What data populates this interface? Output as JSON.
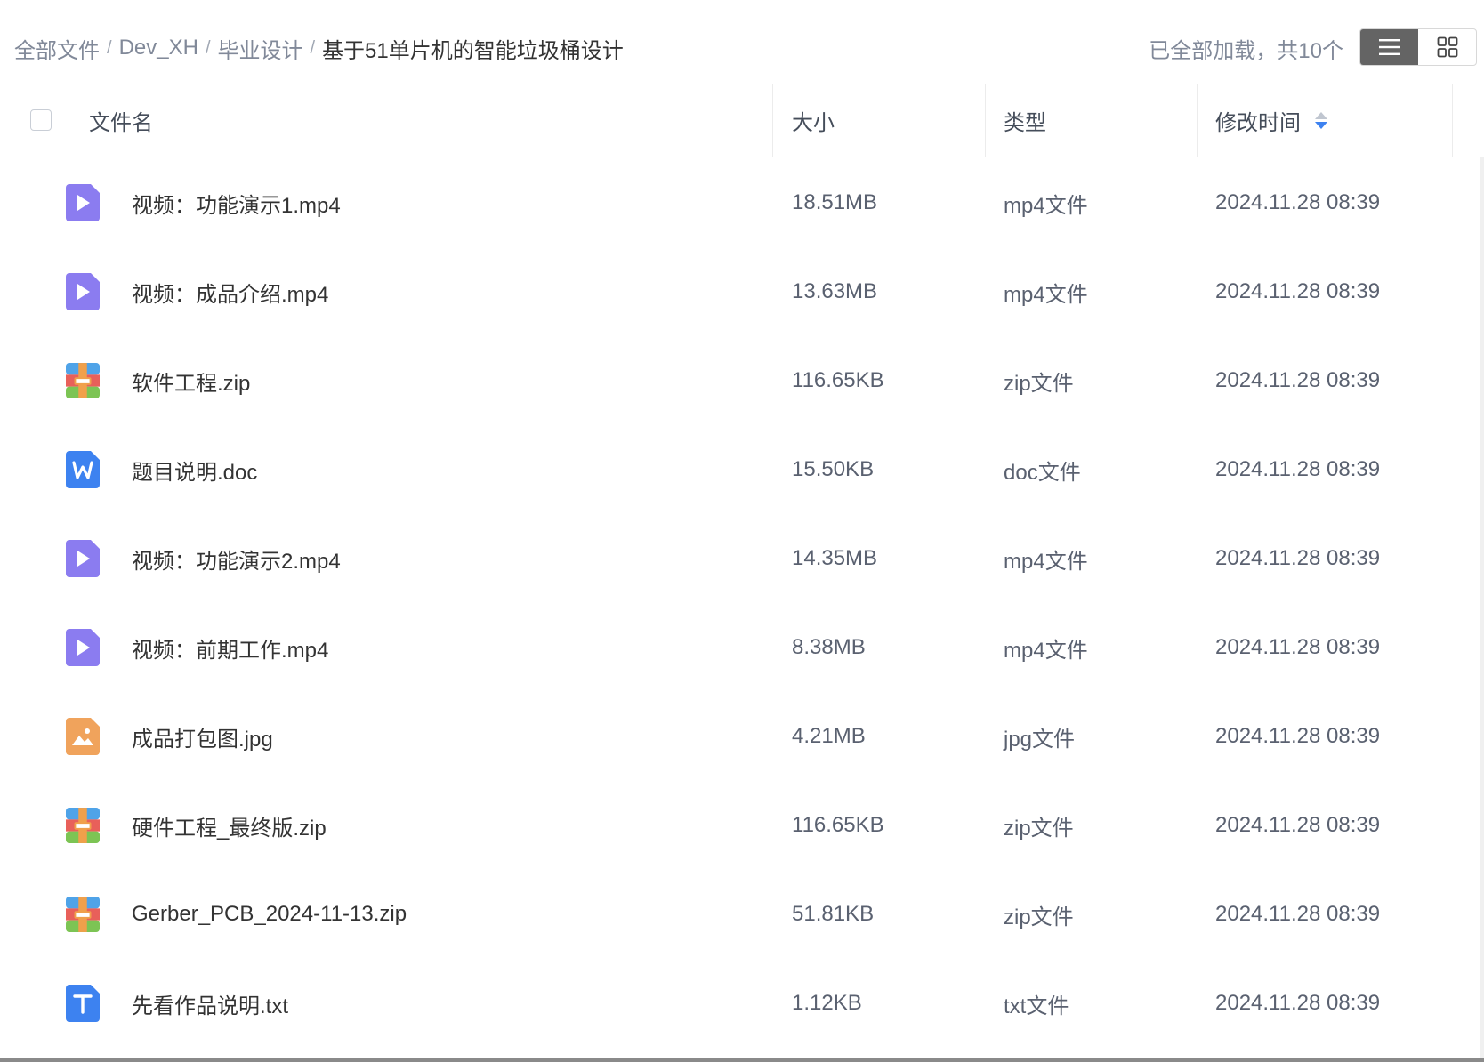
{
  "breadcrumb": {
    "items": [
      "全部文件",
      "Dev_XH",
      "毕业设计"
    ],
    "current": "基于51单片机的智能垃圾桶设计",
    "separator": "/"
  },
  "status": "已全部加载，共10个",
  "view_toggle": {
    "active": "list"
  },
  "columns": {
    "name": "文件名",
    "size": "大小",
    "type": "类型",
    "modified": "修改时间"
  },
  "files": [
    {
      "icon": "video-file-icon",
      "name": "视频：功能演示1.mp4",
      "size": "18.51MB",
      "type": "mp4文件",
      "modified": "2024.11.28 08:39"
    },
    {
      "icon": "video-file-icon",
      "name": "视频：成品介绍.mp4",
      "size": "13.63MB",
      "type": "mp4文件",
      "modified": "2024.11.28 08:39"
    },
    {
      "icon": "zip-file-icon",
      "name": "软件工程.zip",
      "size": "116.65KB",
      "type": "zip文件",
      "modified": "2024.11.28 08:39"
    },
    {
      "icon": "word-file-icon",
      "name": "题目说明.doc",
      "size": "15.50KB",
      "type": "doc文件",
      "modified": "2024.11.28 08:39"
    },
    {
      "icon": "video-file-icon",
      "name": "视频：功能演示2.mp4",
      "size": "14.35MB",
      "type": "mp4文件",
      "modified": "2024.11.28 08:39"
    },
    {
      "icon": "video-file-icon",
      "name": "视频：前期工作.mp4",
      "size": "8.38MB",
      "type": "mp4文件",
      "modified": "2024.11.28 08:39"
    },
    {
      "icon": "image-file-icon",
      "name": "成品打包图.jpg",
      "size": "4.21MB",
      "type": "jpg文件",
      "modified": "2024.11.28 08:39"
    },
    {
      "icon": "zip-file-icon",
      "name": "硬件工程_最终版.zip",
      "size": "116.65KB",
      "type": "zip文件",
      "modified": "2024.11.28 08:39"
    },
    {
      "icon": "zip-file-icon",
      "name": "Gerber_PCB_2024-11-13.zip",
      "size": "51.81KB",
      "type": "zip文件",
      "modified": "2024.11.28 08:39"
    },
    {
      "icon": "text-file-icon",
      "name": "先看作品说明.txt",
      "size": "1.12KB",
      "type": "txt文件",
      "modified": "2024.11.28 08:39"
    }
  ],
  "colors": {
    "video": "#8b7cf0",
    "zip_top": "#4fa3e8",
    "zip_mid": "#e8605a",
    "zip_bottom": "#7cc454",
    "zip_band": "#f0a04b",
    "word": "#3d82f0",
    "image": "#f0a35c",
    "text": "#3d82f0",
    "sort_active": "#3d82f0",
    "toggle_active": "#646464"
  }
}
